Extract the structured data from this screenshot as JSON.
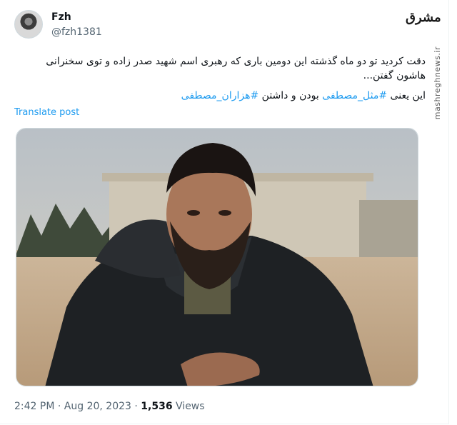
{
  "author": {
    "name": "Fzh",
    "handle": "@fzh1381"
  },
  "brand": {
    "logo_text": "مشرق",
    "vertical_text": "mashreghnews.ir"
  },
  "tweet": {
    "line1": "دقت کردید تو دو ماه گذشته این دومین باری که رهبری اسم شهید صدر زاده و توی سخنرانی هاشون گفتن...",
    "line2_prefix": "این یعنی ",
    "hashtag1": "#مثل_مصطفی",
    "line2_middle": " بودن و داشتن ",
    "hashtag2": "#هزاران_مصطفی",
    "translate_label": "Translate post"
  },
  "meta": {
    "time": "2:42 PM",
    "separator": " · ",
    "date": "Aug 20, 2023",
    "views_count": "1,536",
    "views_label": " Views"
  },
  "colors": {
    "link": "#1d9bf0",
    "text": "#0f1419",
    "muted": "#536471"
  }
}
